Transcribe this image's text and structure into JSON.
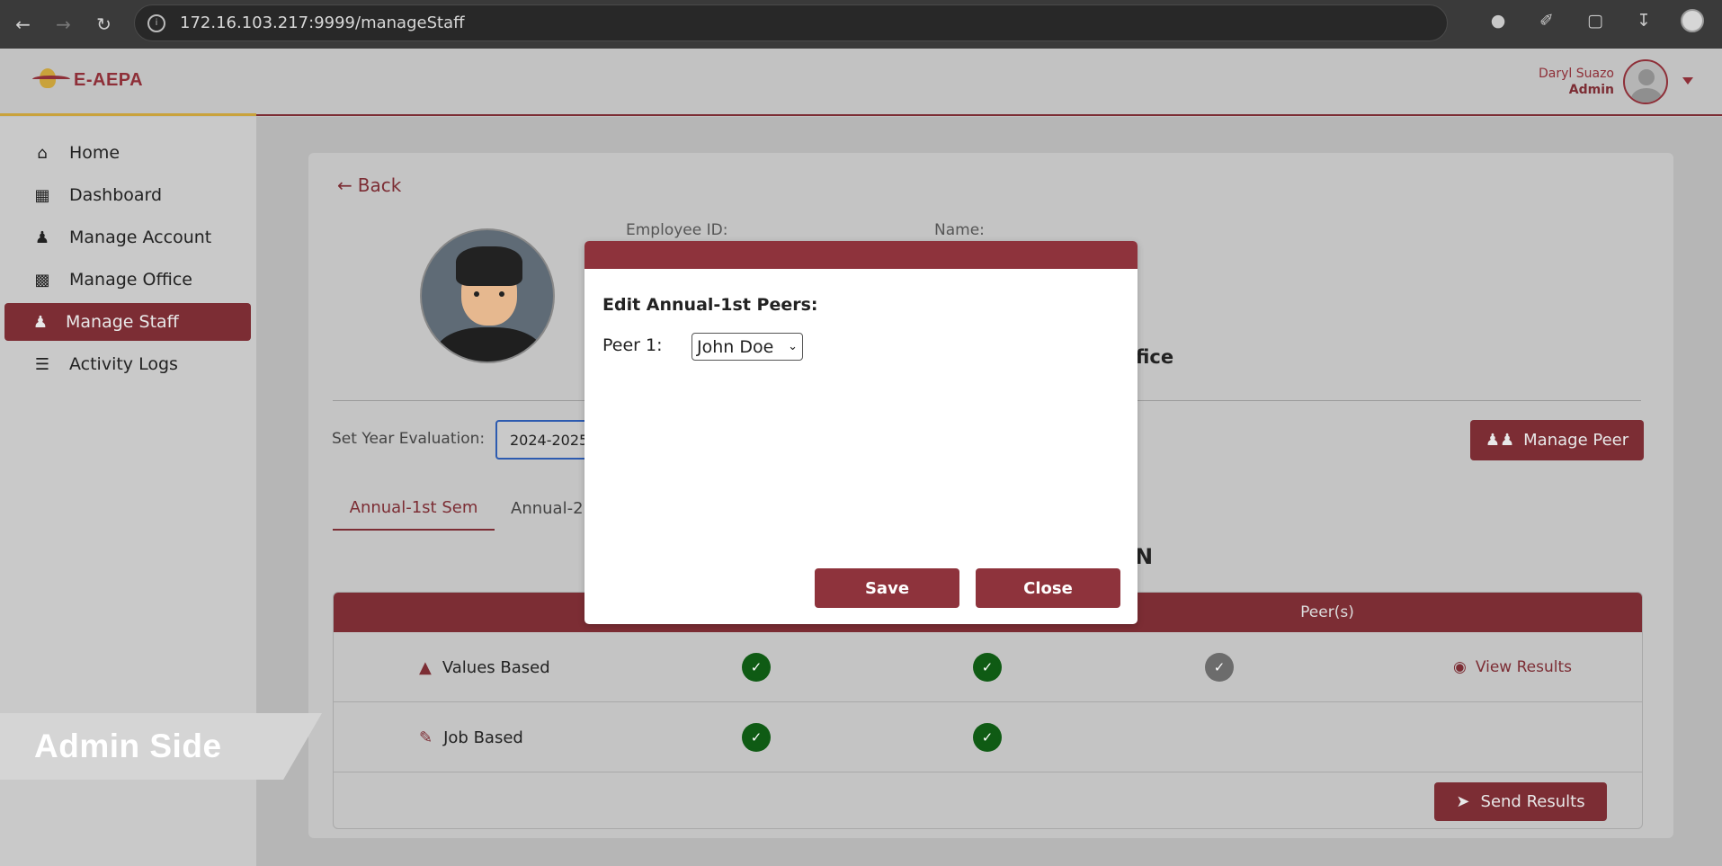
{
  "browser": {
    "url": "172.16.103.217:9999/manageStaff",
    "icons": [
      "back-icon",
      "forward-icon",
      "reload-icon",
      "site-info-icon",
      "mic-icon",
      "eyedropper-icon",
      "extensions-icon",
      "download-icon",
      "profile-icon"
    ]
  },
  "app": {
    "logo_text": "E-AEPA",
    "user_name": "Daryl Suazo",
    "user_role": "Admin"
  },
  "sidebar": {
    "items": [
      {
        "label": "Home",
        "icon": "home-icon"
      },
      {
        "label": "Dashboard",
        "icon": "dashboard-icon"
      },
      {
        "label": "Manage Account",
        "icon": "users-icon"
      },
      {
        "label": "Manage Office",
        "icon": "building-icon"
      },
      {
        "label": "Manage Staff",
        "icon": "user-icon",
        "active": true
      },
      {
        "label": "Activity Logs",
        "icon": "list-icon"
      }
    ]
  },
  "main": {
    "back_label": "Back",
    "employee_id_label": "Employee ID:",
    "name_label": "Name:",
    "office_fragment": "ffice",
    "year_label": "Set Year Evaluation:",
    "year_value": "2024-2025",
    "manage_peer_label": "Manage Peer",
    "tabs": [
      "Annual-1st Sem",
      "Annual-2"
    ],
    "title_fragment": "N",
    "table": {
      "peers_header": "Peer(s)",
      "rows": [
        {
          "label": "Values Based",
          "icon": "graduation-cap-icon",
          "status": [
            "complete",
            "complete",
            "pending"
          ],
          "action": "View Results"
        },
        {
          "label": "Job Based",
          "icon": "scroll-icon",
          "status": [
            "complete",
            "complete"
          ]
        }
      ]
    },
    "send_results_label": "Send Results"
  },
  "ribbon_text": "Admin Side",
  "modal": {
    "title": "Edit Annual-1st Peers:",
    "peer_label": "Peer 1:",
    "peer_value": "John Doe",
    "save_label": "Save",
    "close_label": "Close"
  },
  "colors": {
    "brand": "#7c2d34",
    "modal_accent": "#8e333c",
    "complete": "#0f5b14",
    "pending": "#6c6c6c"
  }
}
